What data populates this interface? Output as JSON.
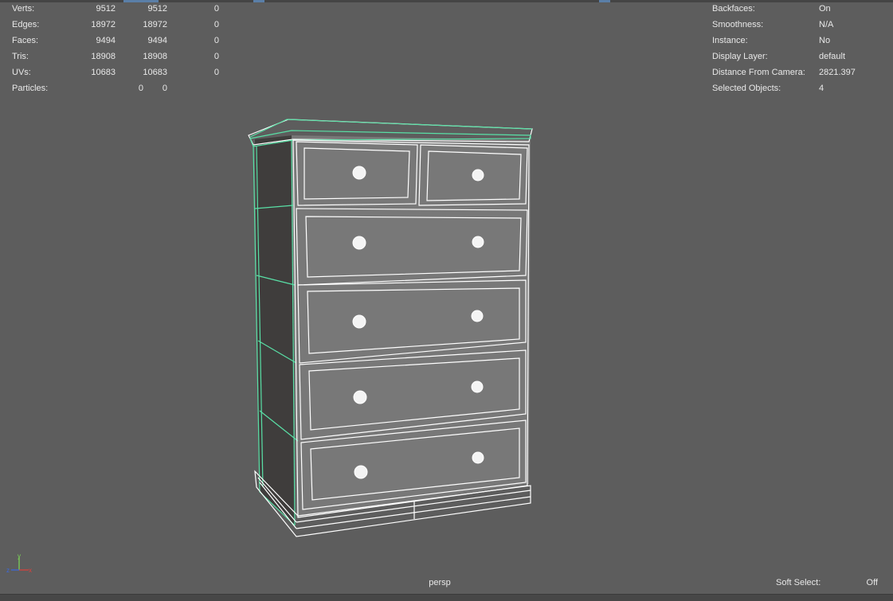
{
  "stats": {
    "rows": [
      {
        "label": "Verts:",
        "v1": "9512",
        "v2": "9512",
        "v3": "0"
      },
      {
        "label": "Edges:",
        "v1": "18972",
        "v2": "18972",
        "v3": "0"
      },
      {
        "label": "Faces:",
        "v1": "9494",
        "v2": "9494",
        "v3": "0"
      },
      {
        "label": "Tris:",
        "v1": "18908",
        "v2": "18908",
        "v3": "0"
      },
      {
        "label": "UVs:",
        "v1": "10683",
        "v2": "10683",
        "v3": "0"
      }
    ],
    "particles": {
      "label": "Particles:",
      "v1": "0",
      "v2": "0"
    }
  },
  "info": [
    {
      "label": "Backfaces:",
      "value": "On"
    },
    {
      "label": "Smoothness:",
      "value": "N/A"
    },
    {
      "label": "Instance:",
      "value": "No"
    },
    {
      "label": "Display Layer:",
      "value": "default"
    },
    {
      "label": "Distance From Camera:",
      "value": "2821.397"
    },
    {
      "label": "Selected Objects:",
      "value": "4"
    }
  ],
  "camera": {
    "label": "persp"
  },
  "soft_select": {
    "label": "Soft Select:",
    "value": "Off"
  },
  "axis": {
    "x": "x",
    "y": "y",
    "z": "z"
  },
  "colors": {
    "viewport_bg": "#5d5d5d",
    "wire": "#ffffff",
    "selection": "#59e0a6",
    "front_face": "#7a7a7a",
    "side_face": "#3f3d3c",
    "axis_x": "#e0403c",
    "axis_y": "#7ed957",
    "axis_z": "#3c6ae0"
  }
}
